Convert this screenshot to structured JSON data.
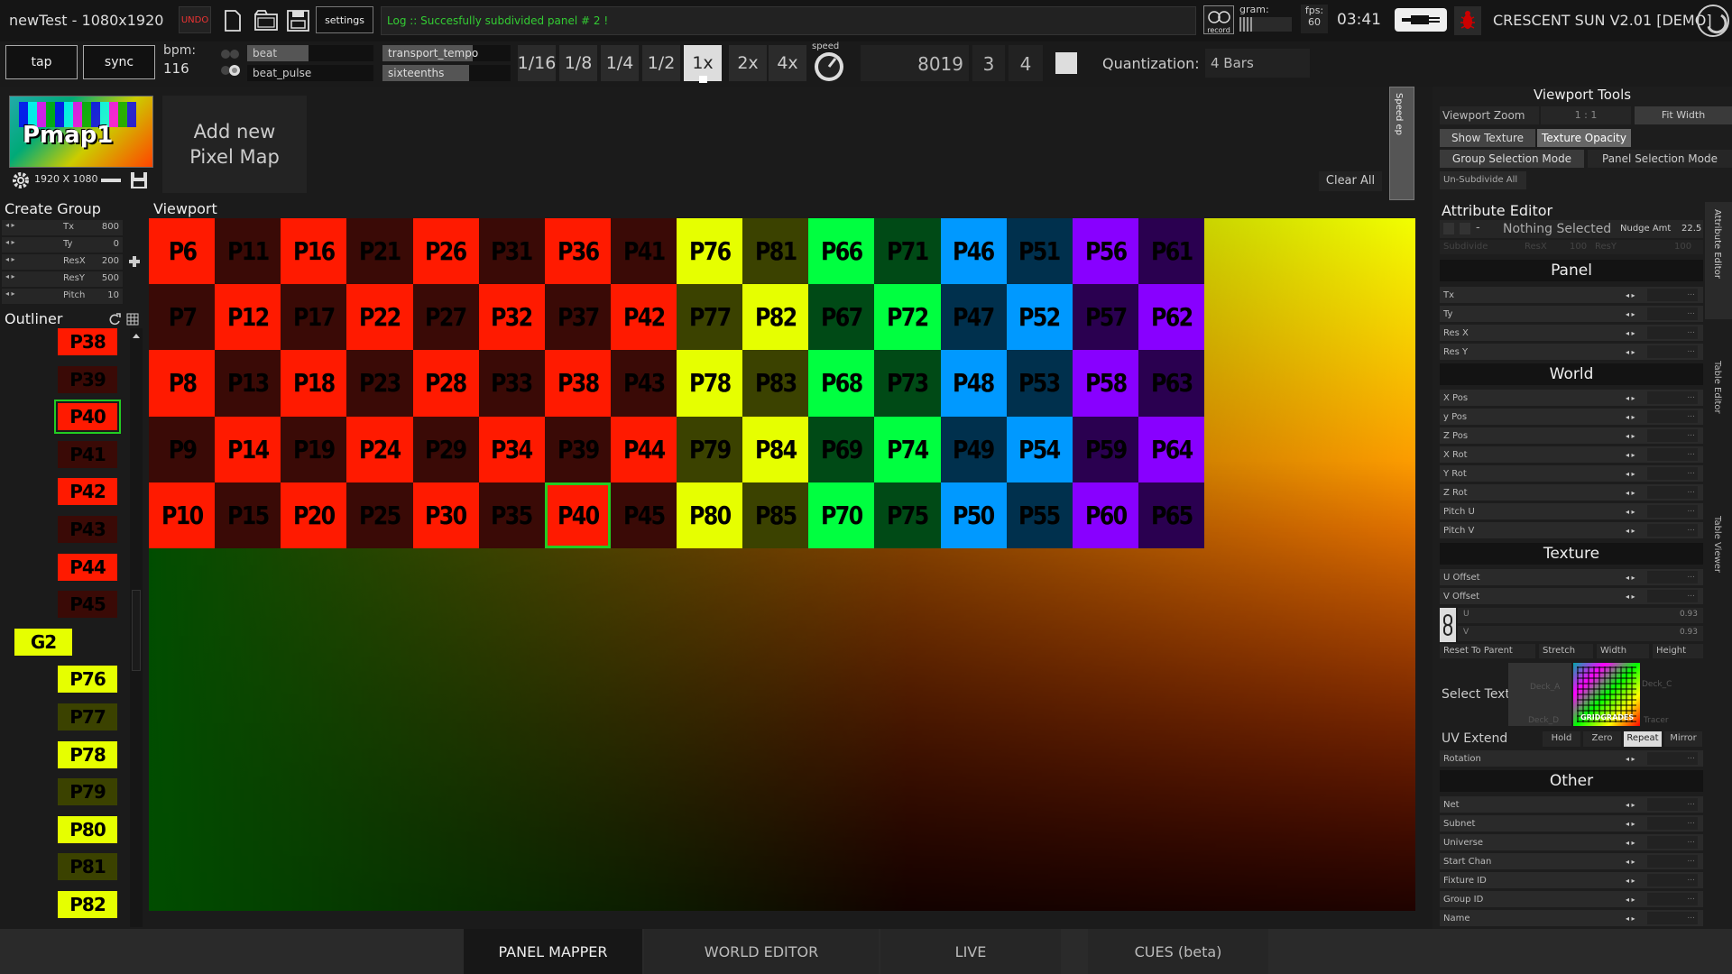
{
  "app": {
    "project_title": "newTest - 1080x1920",
    "brand": "CRESCENT SUN V2.01 [DEMO]"
  },
  "toolbar": {
    "undo": "UNDO",
    "settings": "settings",
    "log": "Log :: Succesfully subdivided panel # 2 !",
    "record": "record",
    "gram_label": "gram:",
    "fps_label": "fps:",
    "fps_value": "60",
    "clock": "03:41"
  },
  "transport": {
    "tap": "tap",
    "sync": "sync",
    "bpm_label": "bpm:",
    "bpm_value": "116",
    "beat": "beat",
    "beat_pulse": "beat_pulse",
    "transport_tempo": "transport_tempo",
    "sixteenths": "sixteenths",
    "divisions": [
      "1/16",
      "1/8",
      "1/4",
      "1/2",
      "1x",
      "2x",
      "4x"
    ],
    "active_division": "1x",
    "speed_label": "speed",
    "counter": "8019",
    "bar": "3",
    "beat_num": "4",
    "quant_label": "Quantization:",
    "quant_value": "4 Bars"
  },
  "pixelmap": {
    "thumb_label": "Pmap1",
    "size": "1920 X 1080",
    "add_new": "Add new\nPixel Map",
    "clear_all": "Clear All",
    "side_tab": "Speed ep"
  },
  "create_group": {
    "title": "Create Group",
    "rows": [
      {
        "label": "Tx",
        "value": "800"
      },
      {
        "label": "Ty",
        "value": "0"
      },
      {
        "label": "ResX",
        "value": "200"
      },
      {
        "label": "ResY",
        "value": "500"
      },
      {
        "label": "Pitch",
        "value": "10"
      }
    ]
  },
  "outliner": {
    "title": "Outliner",
    "items": [
      {
        "label": "P38",
        "color": "#ff1a00"
      },
      {
        "label": "P39",
        "color": "#3a0a06"
      },
      {
        "label": "P40",
        "color": "#ff1a00",
        "selected": true
      },
      {
        "label": "P41",
        "color": "#3a0a06"
      },
      {
        "label": "P42",
        "color": "#ff1a00"
      },
      {
        "label": "P43",
        "color": "#3a0a06"
      },
      {
        "label": "P44",
        "color": "#ff1a00"
      },
      {
        "label": "P45",
        "color": "#3a0a06"
      },
      {
        "label": "G2",
        "color": "#e6ff00",
        "group": true
      },
      {
        "label": "P76",
        "color": "#e6ff00"
      },
      {
        "label": "P77",
        "color": "#3b4200"
      },
      {
        "label": "P78",
        "color": "#e6ff00"
      },
      {
        "label": "P79",
        "color": "#3b4200"
      },
      {
        "label": "P80",
        "color": "#e6ff00"
      },
      {
        "label": "P81",
        "color": "#3b4200"
      },
      {
        "label": "P82",
        "color": "#e6ff00"
      }
    ]
  },
  "viewport": {
    "title": "Viewport",
    "rows": [
      [
        "P6",
        "P11",
        "P16",
        "P21",
        "P26",
        "P31",
        "P36",
        "P41",
        "P76",
        "P81",
        "P66",
        "P71",
        "P46",
        "P51",
        "P56",
        "P61"
      ],
      [
        "P7",
        "P12",
        "P17",
        "P22",
        "P27",
        "P32",
        "P37",
        "P42",
        "P77",
        "P82",
        "P67",
        "P72",
        "P47",
        "P52",
        "P57",
        "P62"
      ],
      [
        "P8",
        "P13",
        "P18",
        "P23",
        "P28",
        "P33",
        "P38",
        "P43",
        "P78",
        "P83",
        "P68",
        "P73",
        "P48",
        "P53",
        "P58",
        "P63"
      ],
      [
        "P9",
        "P14",
        "P19",
        "P24",
        "P29",
        "P34",
        "P39",
        "P44",
        "P79",
        "P84",
        "P69",
        "P74",
        "P49",
        "P54",
        "P59",
        "P64"
      ],
      [
        "P10",
        "P15",
        "P20",
        "P25",
        "P30",
        "P35",
        "P40",
        "P45",
        "P80",
        "P85",
        "P70",
        "P75",
        "P50",
        "P55",
        "P60",
        "P65"
      ]
    ],
    "column_colors": [
      {
        "bright": "#ff1a00",
        "dark": "#3a0a06"
      },
      {
        "bright": "#ff1a00",
        "dark": "#3a0a06"
      },
      {
        "bright": "#ff1a00",
        "dark": "#3a0a06"
      },
      {
        "bright": "#ff1a00",
        "dark": "#3a0a06"
      },
      {
        "bright": "#e6ff00",
        "dark": "#3b4200"
      },
      {
        "bright": "#00ff40",
        "dark": "#004a16"
      },
      {
        "bright": "#0099ff",
        "dark": "#00304d"
      },
      {
        "bright": "#8800ff",
        "dark": "#2a0050"
      }
    ],
    "selected_cell": "P40"
  },
  "viewport_tools": {
    "title": "Viewport Tools",
    "zoom_label": "Viewport Zoom",
    "zoom_value": "1 : 1",
    "fit_width": "Fit Width",
    "show_texture": "Show Texture",
    "texture_opacity": "Texture Opacity",
    "group_mode": "Group Selection Mode",
    "panel_mode": "Panel Selection Mode",
    "unsubdivide": "Un-Subdivide All"
  },
  "attribute_editor": {
    "title": "Attribute Editor",
    "nothing_selected": "Nothing Selected",
    "nudge_label": "Nudge Amt",
    "nudge_value": "22.5",
    "subdivide": "Subdivide",
    "resx": "ResX",
    "resx_val": "100",
    "resy": "ResY",
    "resy_val": "100",
    "panel_title": "Panel",
    "panel_rows": [
      "Tx",
      "Ty",
      "Res X",
      "Res Y"
    ],
    "world_title": "World",
    "world_rows": [
      "X Pos",
      "y Pos",
      "Z Pos",
      "X Rot",
      "Y Rot",
      "Z Rot",
      "Pitch U",
      "Pitch V"
    ],
    "texture_title": "Texture",
    "texture_rows": [
      "U Offset",
      "V Offset"
    ],
    "u_label": "U",
    "u_value": "0.93",
    "v_label": "V",
    "v_value": "0.93",
    "fit_buttons": [
      "Reset To Parent",
      "Stretch",
      "Width",
      "Height"
    ],
    "select_text": "Select Text",
    "decks": [
      "Deck_A",
      "Deck_C",
      "Deck_D",
      "Tracer"
    ],
    "deck_label": "GRIDGRADES",
    "uv_extend_label": "UV Extend",
    "uv_extend_options": [
      "Hold",
      "Zero",
      "Repeat",
      "Mirror"
    ],
    "uv_extend_active": "Repeat",
    "rotation": "Rotation",
    "other_title": "Other",
    "other_rows": [
      "Net",
      "Subnet",
      "Universe",
      "Start Chan",
      "Fixture ID",
      "Group ID",
      "Name"
    ],
    "side_tabs": [
      "Attribute Editor",
      "Table Editor",
      "Table Viewer"
    ]
  },
  "bottom_tabs": [
    "PANEL MAPPER",
    "WORLD EDITOR",
    "LIVE",
    "CUES (beta)"
  ],
  "active_tab": "PANEL MAPPER"
}
